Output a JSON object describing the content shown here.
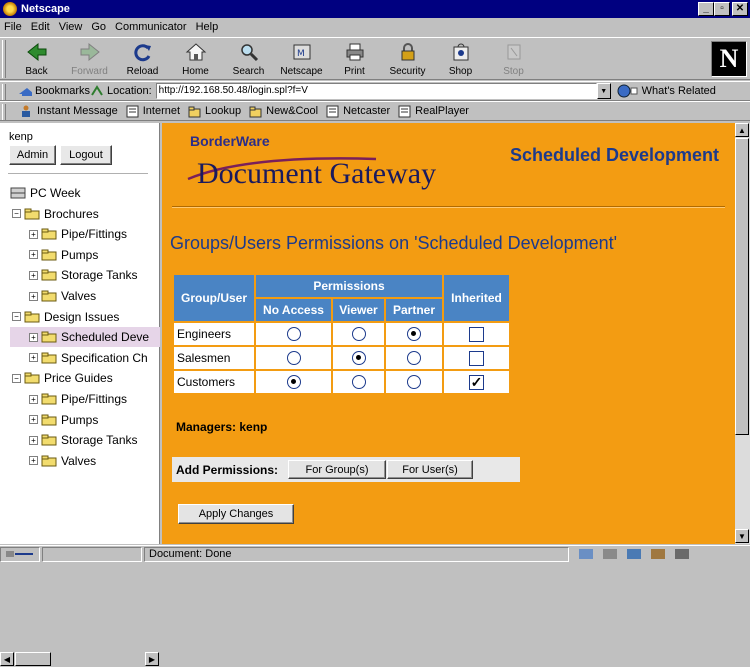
{
  "window": {
    "title": "Netscape"
  },
  "menu": {
    "items": [
      "File",
      "Edit",
      "View",
      "Go",
      "Communicator",
      "Help"
    ]
  },
  "toolbar": {
    "buttons": [
      {
        "label": "Back",
        "icon": "back-arrow-icon",
        "disabled": false
      },
      {
        "label": "Forward",
        "icon": "forward-arrow-icon",
        "disabled": true
      },
      {
        "label": "Reload",
        "icon": "reload-icon",
        "disabled": false
      },
      {
        "label": "Home",
        "icon": "home-icon",
        "disabled": false
      },
      {
        "label": "Search",
        "icon": "search-icon",
        "disabled": false
      },
      {
        "label": "Netscape",
        "icon": "netscape-icon",
        "disabled": false
      },
      {
        "label": "Print",
        "icon": "print-icon",
        "disabled": false
      },
      {
        "label": "Security",
        "icon": "lock-icon",
        "disabled": false
      },
      {
        "label": "Shop",
        "icon": "shop-icon",
        "disabled": false
      },
      {
        "label": "Stop",
        "icon": "stop-icon",
        "disabled": true
      }
    ]
  },
  "location": {
    "bookmarks_label": "Bookmarks",
    "location_label": "Location:",
    "url": "http://192.168.50.48/login.spl?f=V",
    "whats_related": "What's Related"
  },
  "personal": {
    "items": [
      "Instant Message",
      "Internet",
      "Lookup",
      "New&Cool",
      "Netcaster",
      "RealPlayer"
    ]
  },
  "sidebar": {
    "user": "kenp",
    "admin_label": "Admin",
    "logout_label": "Logout",
    "tree": [
      {
        "label": "PC Week",
        "level": 0,
        "expander": "",
        "selected": false
      },
      {
        "label": "Brochures",
        "level": 1,
        "expander": "−",
        "selected": false
      },
      {
        "label": "Pipe/Fittings",
        "level": 2,
        "expander": "+",
        "selected": false
      },
      {
        "label": "Pumps",
        "level": 2,
        "expander": "+",
        "selected": false
      },
      {
        "label": "Storage Tanks",
        "level": 2,
        "expander": "+",
        "selected": false
      },
      {
        "label": "Valves",
        "level": 2,
        "expander": "+",
        "selected": false
      },
      {
        "label": "Design Issues",
        "level": 1,
        "expander": "−",
        "selected": false
      },
      {
        "label": "Scheduled Deve",
        "level": 2,
        "expander": "+",
        "selected": true
      },
      {
        "label": "Specification Ch",
        "level": 2,
        "expander": "+",
        "selected": false
      },
      {
        "label": "Price Guides",
        "level": 1,
        "expander": "−",
        "selected": false
      },
      {
        "label": "Pipe/Fittings",
        "level": 2,
        "expander": "+",
        "selected": false
      },
      {
        "label": "Pumps",
        "level": 2,
        "expander": "+",
        "selected": false
      },
      {
        "label": "Storage Tanks",
        "level": 2,
        "expander": "+",
        "selected": false
      },
      {
        "label": "Valves",
        "level": 2,
        "expander": "+",
        "selected": false
      }
    ]
  },
  "main": {
    "brand_top": "BorderWare",
    "brand_main": "Document Gateway",
    "doc_title": "Scheduled Development",
    "page_title": "Groups/Users Permissions on 'Scheduled Development'",
    "table": {
      "col_group": "Group/User",
      "col_permissions": "Permissions",
      "col_inherited": "Inherited",
      "sub_cols": [
        "No Access",
        "Viewer",
        "Partner"
      ],
      "rows": [
        {
          "name": "Engineers",
          "selected": 2,
          "inherited": false
        },
        {
          "name": "Salesmen",
          "selected": 1,
          "inherited": false
        },
        {
          "name": "Customers",
          "selected": 0,
          "inherited": true
        }
      ]
    },
    "managers": "Managers: kenp",
    "add_permissions_label": "Add Permissions:",
    "for_groups": "For Group(s)",
    "for_users": "For User(s)",
    "apply": "Apply Changes"
  },
  "status": {
    "text": "Document: Done"
  },
  "colors": {
    "page_bg": "#f39c12",
    "heading_blue": "#1c3a8c",
    "table_header": "#4a84c4",
    "titlebar": "#000080"
  }
}
